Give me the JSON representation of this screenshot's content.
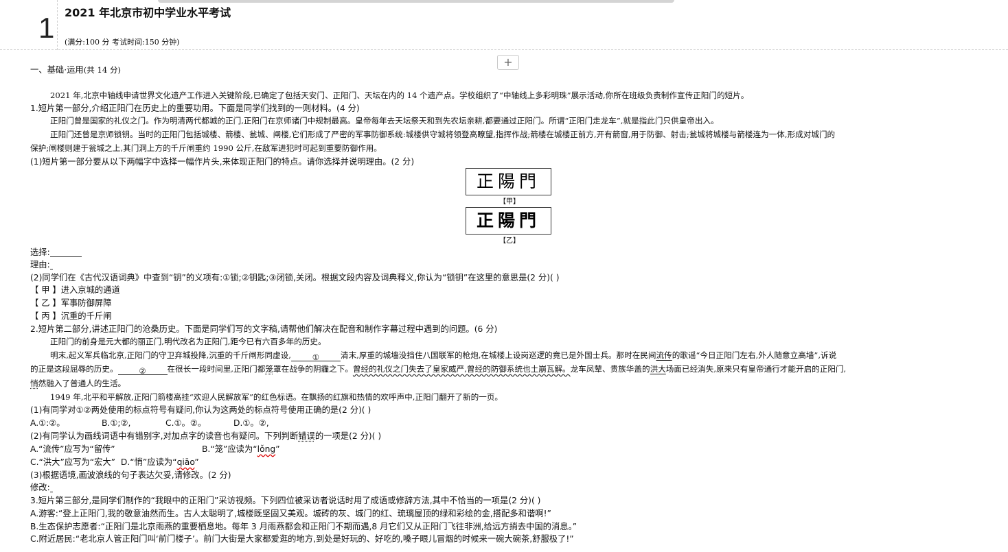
{
  "header": {
    "question_number": "1",
    "title": "2021 年北京市初中学业水平考试",
    "subtitle": "(满分:100 分   考试时间:150 分钟)"
  },
  "toolbar": {
    "add_label": "+"
  },
  "section1": {
    "heading": "一、基础·运用",
    "score": "(共 14 分)"
  },
  "intro": "2021 年,北京中轴线申请世界文化遗产工作进入关键阶段,已确定了包括天安门、正阳门、天坛在内的 14 个遗产点。学校组织了“中轴线上多彩明珠”展示活动,你所在班级负责制作宣传正阳门的短片。",
  "q1": {
    "stem": "1.短片第一部分,介绍正阳门在历史上的重要功用。下面是同学们找到的一则材料。(4 分)",
    "material_p1": "正阳门曾是国家的礼仪之门。作为明清两代都城的正门,正阳门在京师诸门中规制最高。皇帝每年去天坛祭天和到先农坛亲耕,都要通过正阳门。所谓“正阳门走龙车”,就是指此门只供皇帝出入。",
    "material_p2a": "正阳门还曾是京师锁钥。当时的正阳门包括城楼、箭楼、瓮城、闸楼,它们形成了严密的军事防御系统:城楼供守城将领登高瞭望,指挥作战;箭楼在城楼正前方,开有箭窗,用于防御、射击;瓮城将城楼与箭楼连为一体,形成对城门的",
    "material_p2b": "保护;闸楼则建于瓮城之上,其门洞上方的千斤闸重约 1990 公斤,在敌军进犯时可起到重要防御作用。",
    "sub1": "(1)短片第一部分要从以下两幅字中选择一幅作片头,来体现正阳门的特点。请你选择并说明理由。(2 分)",
    "calligraphy_a": "正陽門",
    "label_a": "【甲】",
    "calligraphy_b": "正陽門",
    "label_b": "【乙】",
    "choose_label": "选择:",
    "reason_label": "理由:",
    "sub2": "(2)同学们在《古代汉语词典》中查到“钥”的义项有:①锁;②钥匙;③闭锁,关闭。根据文段内容及词典释义,你认为“锁钥”在这里的意思是(2 分)(        )",
    "options": [
      "【 甲 】进入京城的通道",
      "【 乙 】军事防御屏障",
      "【 丙 】沉重的千斤闸"
    ]
  },
  "q2": {
    "stem": "2.短片第二部分,讲述正阳门的沧桑历史。下面是同学们写的文字稿,请帮他们解决在配音和制作字幕过程中遇到的问题。(6 分)",
    "p1": "正阳门的前身是元大都的丽正门,明代改名为正阳门,距今已有六百多年的历史。",
    "p2_a": "明末,起义军兵临北京,正阳门的守卫弃城投降,沉重的千斤闸形同虚设,",
    "blank1": "①",
    "p2_b": "清末,厚重的城墙没挡住八国联军的枪炮,在城楼上设岗巡逻的竟已是外国士兵。那时在民间",
    "p2_liuchuan": "流传",
    "p2_c": "的歌谣“今日正阳门左右,外人随意立高墙”,诉说",
    "p3_a": "的正是这段屈辱的历史。",
    "blank2": "②",
    "p3_b": "在很长一段时间里,正阳门都",
    "p3_long": "笼",
    "p3_c": "罩在战争的阴霾之下。",
    "p3_wavy": "曾经的礼仪之门失去了皇家威严,曾经的防御系统也土崩瓦解。",
    "p3_d": "龙车凤辇、贵族华盖的",
    "p3_hongda": "洪大",
    "p3_e": "场面已经消失,原来只有皇帝通行才能开启的正阳门,",
    "p4_a": "",
    "p4_qiao": "悄",
    "p4_b": "然融入了普通人的生活。",
    "p5": "1949 年,北平和平解放,正阳门箭楼高挂“欢迎人民解放军”的红色标语。在飘扬的红旗和热情的欢呼声中,正阳门翻开了新的一页。",
    "sub1": "(1)有同学对①②两处使用的标点符号有疑问,你认为这两处的标点符号使用正确的是(2 分)(       )",
    "sub1_options": [
      "A.①:②。",
      "B.①;②,",
      "C.①。②。",
      "D.①。②,"
    ],
    "sub2_a": "(2)有同学认为画线词语中有错别字,对加点字的读音也有疑问。下列判断",
    "sub2_wrong": "错误",
    "sub2_b": "的一项是(2 分)(       )",
    "sub2_optA": "A.“流传”应写为“留传”",
    "sub2_optB_a": "B.“笼”应读为“",
    "sub2_optB_pinyin": "lǒng",
    "sub2_optB_b": "”",
    "sub2_optC": "C.“洪大”应写为“宏大”",
    "sub2_optD_a": "D.“悄”应读为“",
    "sub2_optD_pinyin": "qiāo",
    "sub2_optD_b": "”",
    "sub3": "(3)根据语境,画波浪线的句子表达欠妥,请修改。(2 分)",
    "modify_label": "修改:"
  },
  "q3": {
    "stem": "3.短片第三部分,是同学们制作的“我眼中的正阳门”采访视频。下列四位被采访者说话时用了成语或修辞方法,其中不恰当的一项是(2 分)(        )",
    "optA": "A.游客:“登上正阳门,我的敬意油然而生。古人太聪明了,城楼既坚固又美观。城砖的灰、城门的红、琉璃屋顶的绿和彩绘的金,搭配多和谐啊!”",
    "optB": "B.生态保护志愿者:“正阳门是北京雨燕的重要栖息地。每年 3 月雨燕都会和正阳门不期而遇,8 月它们又从正阳门飞往非洲,给远方捎去中国的消息。”",
    "optC": "C.附近居民:“老北京人管正阳门叫‘前门楼子’。前门大街是大家都爱逛的地方,到处是好玩的、好吃的,嗓子眼儿冒烟的时候来一碗大碗茶,舒服极了!”"
  }
}
